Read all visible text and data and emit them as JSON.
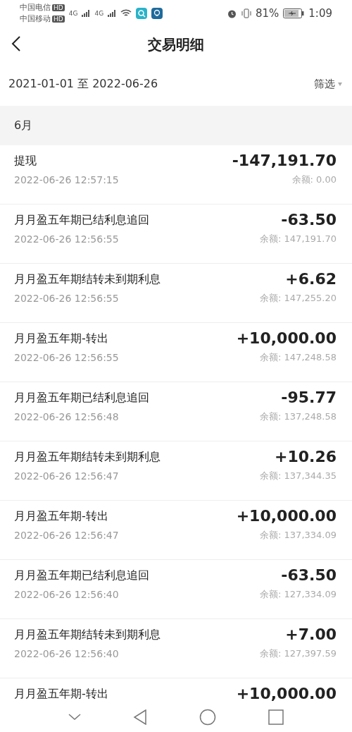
{
  "status_bar": {
    "carriers": [
      {
        "name": "中国电信",
        "badge": "HD"
      },
      {
        "name": "中国移动",
        "badge": "HD"
      }
    ],
    "network": [
      "4G",
      "4G"
    ],
    "battery_percent": "81%",
    "time": "1:09"
  },
  "header": {
    "title": "交易明细"
  },
  "filter": {
    "date_range": "2021-01-01 至 2022-06-26",
    "button": "筛选"
  },
  "month": "6月",
  "transactions": [
    {
      "title": "提现",
      "time": "2022-06-26 12:57:15",
      "amount": "-147,191.70",
      "balance_label": "余额:",
      "balance": "0.00"
    },
    {
      "title": "月月盈五年期已结利息追回",
      "time": "2022-06-26 12:56:55",
      "amount": "-63.50",
      "balance_label": "余额:",
      "balance": "147,191.70"
    },
    {
      "title": "月月盈五年期结转未到期利息",
      "time": "2022-06-26 12:56:55",
      "amount": "+6.62",
      "balance_label": "余额:",
      "balance": "147,255.20"
    },
    {
      "title": "月月盈五年期-转出",
      "time": "2022-06-26 12:56:55",
      "amount": "+10,000.00",
      "balance_label": "余额:",
      "balance": "147,248.58"
    },
    {
      "title": "月月盈五年期已结利息追回",
      "time": "2022-06-26 12:56:48",
      "amount": "-95.77",
      "balance_label": "余额:",
      "balance": "137,248.58"
    },
    {
      "title": "月月盈五年期结转未到期利息",
      "time": "2022-06-26 12:56:47",
      "amount": "+10.26",
      "balance_label": "余额:",
      "balance": "137,344.35"
    },
    {
      "title": "月月盈五年期-转出",
      "time": "2022-06-26 12:56:47",
      "amount": "+10,000.00",
      "balance_label": "余额:",
      "balance": "137,334.09"
    },
    {
      "title": "月月盈五年期已结利息追回",
      "time": "2022-06-26 12:56:40",
      "amount": "-63.50",
      "balance_label": "余额:",
      "balance": "127,334.09"
    },
    {
      "title": "月月盈五年期结转未到期利息",
      "time": "2022-06-26 12:56:40",
      "amount": "+7.00",
      "balance_label": "余额:",
      "balance": "127,397.59"
    },
    {
      "title": "月月盈五年期-转出",
      "amount": "+10,000.00"
    }
  ]
}
